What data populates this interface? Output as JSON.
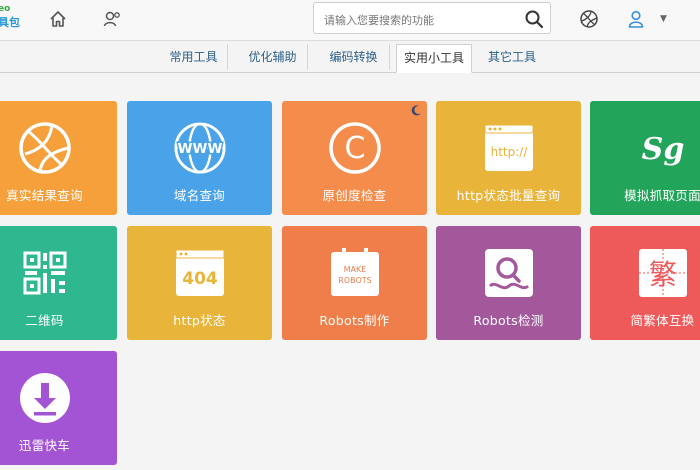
{
  "header": {
    "logo_top": "eo",
    "logo_main": "具包",
    "search_placeholder": "请输入您要搜索的功能"
  },
  "tabs": [
    {
      "label": "常用工具"
    },
    {
      "label": "优化辅助"
    },
    {
      "label": "编码转换"
    },
    {
      "label": "实用小工具",
      "active": true
    },
    {
      "label": "其它工具"
    }
  ],
  "tools": [
    {
      "label": "真实结果查询",
      "color": "#f5a03a",
      "icon": "basketball-icon"
    },
    {
      "label": "域名查询",
      "color": "#4aa3e8",
      "icon": "globe-www-icon"
    },
    {
      "label": "原创度检查",
      "color": "#f48c4c",
      "icon": "copyright-icon"
    },
    {
      "label": "http状态批量查询",
      "color": "#e8b43a",
      "icon": "browser-http-icon"
    },
    {
      "label": "模拟抓取页面",
      "color": "#22a55a",
      "icon": "spider-sg-icon"
    },
    {
      "label": "二维码",
      "color": "#2fb890",
      "icon": "qrcode-icon"
    },
    {
      "label": "http状态",
      "color": "#e8b43a",
      "icon": "http-404-icon"
    },
    {
      "label": "Robots制作",
      "color": "#f07e4a",
      "icon": "robots-make-icon"
    },
    {
      "label": "Robots检测",
      "color": "#a4589c",
      "icon": "robots-check-icon"
    },
    {
      "label": "简繁体互换",
      "color": "#ee5a5a",
      "icon": "traditional-char-icon"
    },
    {
      "label": "迅雷快车",
      "color": "#a354d4",
      "icon": "download-icon"
    }
  ],
  "icon_text": {
    "www": "WWW",
    "copyright": "C",
    "http": "http://",
    "sg": "Sg",
    "code404": "404",
    "make": "MAKE",
    "robots": "ROBOTS",
    "fan": "繁"
  }
}
